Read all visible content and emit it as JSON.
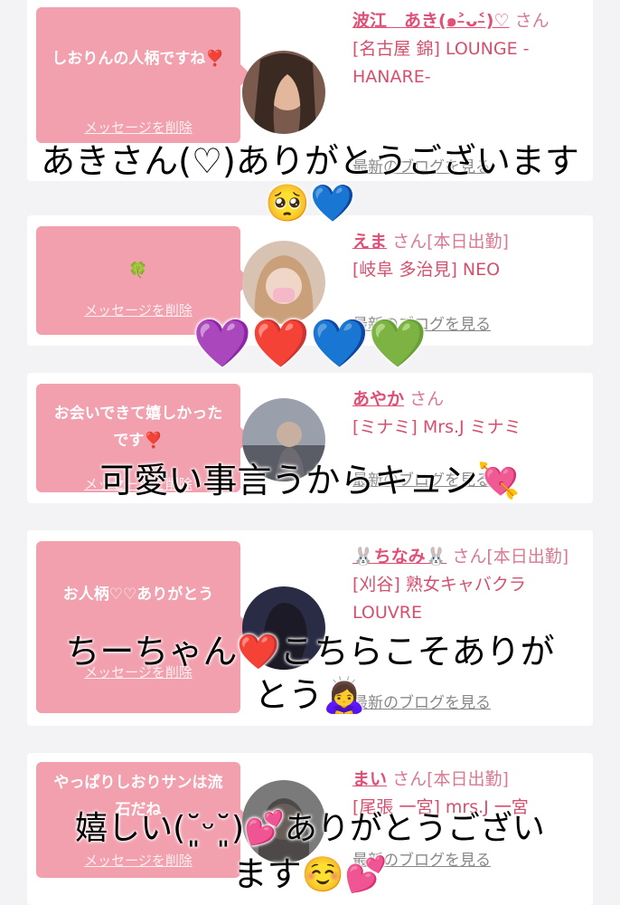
{
  "cards": [
    {
      "message": "しおりんの人柄ですね❣️",
      "delete_label": "メッセージを削除",
      "name": "波江　あき(๑˃̵ᴗ˂̵)♡",
      "san": "さん",
      "shop": "[名古屋 錦] LOUNGE -HANARE-",
      "blog_label": "最新のブログを見る",
      "avatar_color": "#7a5a4d"
    },
    {
      "message": "🍀",
      "delete_label": "メッセージを削除",
      "name": "えま",
      "san": "さん[本日出勤]",
      "shop": "[岐阜 多治見] NEO",
      "blog_label": "最新のブログを見る",
      "avatar_color": "#c9a98f"
    },
    {
      "message": "お会いできて嬉しかったです❣️",
      "delete_label": "メッセージを削除",
      "name": "あやか",
      "san": "さん",
      "shop": "[ミナミ] Mrs.J ミナミ",
      "blog_label": "最新のブログを見る",
      "avatar_color": "#8c8f9a"
    },
    {
      "message": "お人柄♡♡ありがとう",
      "delete_label": "メッセージを削除",
      "name": "🐰ちなみ🐰",
      "san": "さん[本日出勤]",
      "shop": "[刈谷] 熟女キャバクラ LOUVRE",
      "blog_label": "最新のブログを見る",
      "avatar_color": "#3e3e5c"
    },
    {
      "message": "やっぱりしおりサンは流石だね",
      "delete_label": "メッセージを削除",
      "name": "まい",
      "san": "さん[本日出勤]",
      "shop": "[尾張 一宮] mrs.J 一宮",
      "blog_label": "最新のブログを見る",
      "avatar_color": "#6b6b6b"
    }
  ],
  "overlays": {
    "o1": "あきさん(♡)ありがとうございます",
    "o1b": "🥺💙",
    "o2": "💜❤️💙💚",
    "o3": "可愛い事言うからキュン💘",
    "o4": "ちーちゃん❤️こちらこそありが",
    "o4b": "とう🙇‍♀️",
    "o5": "嬉しい(˘͈ᵕ˘͈)💕ありがとうござい",
    "o5b": "ます☺️💕"
  },
  "colors": {
    "bubble": "#f29fae",
    "name": "#e04f76",
    "background": "#f3f3f5"
  }
}
